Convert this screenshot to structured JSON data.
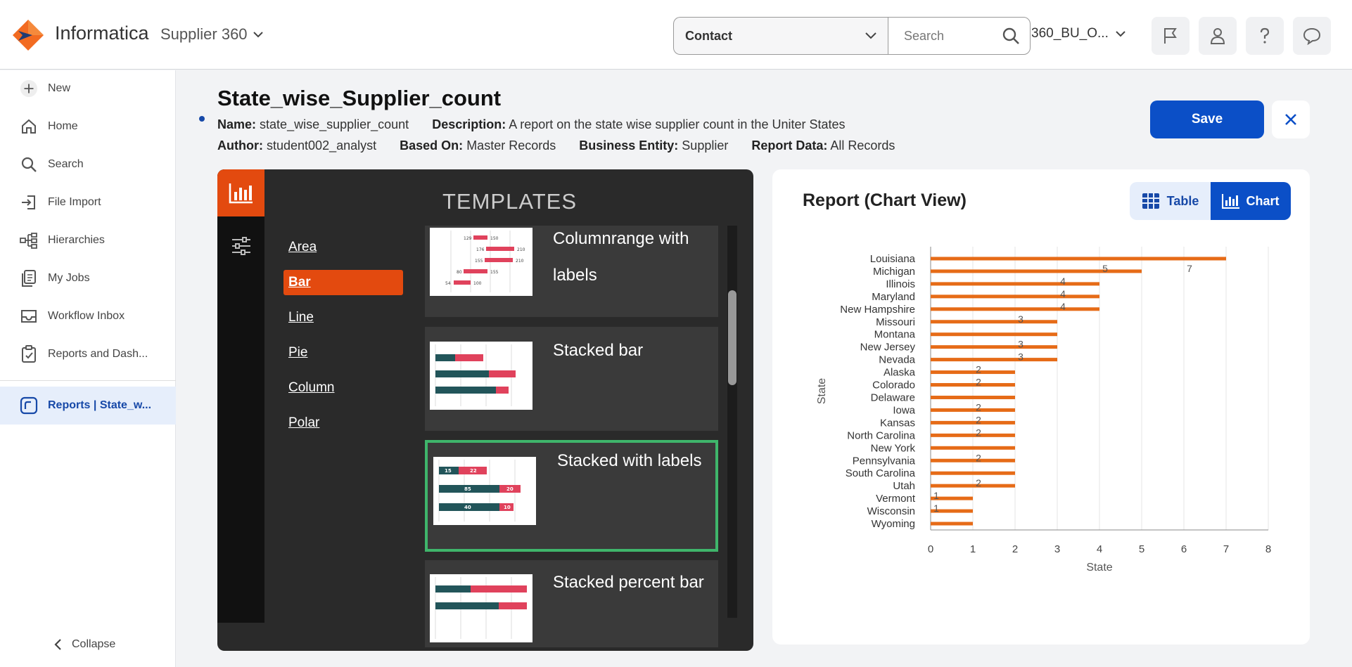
{
  "header": {
    "brand": "Informatica",
    "product": "Supplier 360",
    "entity": "Contact",
    "search_placeholder": "Search",
    "org": "360_BU_O..."
  },
  "sidebar": {
    "items": [
      {
        "label": "New",
        "icon": "plus-icon"
      },
      {
        "label": "Home",
        "icon": "home-icon"
      },
      {
        "label": "Search",
        "icon": "search-icon"
      },
      {
        "label": "File Import",
        "icon": "file-import-icon"
      },
      {
        "label": "Hierarchies",
        "icon": "hierarchy-icon"
      },
      {
        "label": "My Jobs",
        "icon": "jobs-icon"
      },
      {
        "label": "Workflow Inbox",
        "icon": "inbox-icon"
      },
      {
        "label": "Reports and Dash..."
      }
    ],
    "active_tab": "Reports | State_w...",
    "collapse": "Collapse"
  },
  "report": {
    "title": "State_wise_Supplier_count",
    "name_label": "Name:",
    "name": "state_wise_supplier_count",
    "description_label": "Description:",
    "description": "A report on the state wise supplier count in the Uniter States",
    "author_label": "Author:",
    "author": "student002_analyst",
    "based_on_label": "Based On:",
    "based_on": "Master Records",
    "entity_label": "Business Entity:",
    "entity": "Supplier",
    "data_label": "Report Data:",
    "data": "All Records",
    "save": "Save"
  },
  "templates": {
    "heading": "TEMPLATES",
    "types": [
      "Area",
      "Bar",
      "Line",
      "Pie",
      "Column",
      "Polar"
    ],
    "active_type": "Bar",
    "cards": [
      {
        "label": "Columnrange with labels"
      },
      {
        "label": "Stacked bar"
      },
      {
        "label": "Stacked with labels"
      },
      {
        "label": "Stacked percent bar"
      }
    ],
    "selected": "Stacked with labels",
    "thumb_labels": {
      "columnrange": [
        "129",
        "150",
        "176",
        "210",
        "155",
        "210",
        "80",
        "155",
        "54",
        "100"
      ],
      "stacked_labels": [
        "15",
        "22",
        "85",
        "20",
        "40",
        "10"
      ]
    }
  },
  "chart_panel": {
    "title": "Report (Chart View)",
    "table_btn": "Table",
    "chart_btn": "Chart"
  },
  "chart_data": {
    "type": "bar",
    "orientation": "horizontal",
    "categories": [
      "Louisiana",
      "Michigan",
      "Illinois",
      "Maryland",
      "New Hampshire",
      "Missouri",
      "Montana",
      "New Jersey",
      "Nevada",
      "Alaska",
      "Colorado",
      "Delaware",
      "Iowa",
      "Kansas",
      "North Carolina",
      "New York",
      "Pennsylvania",
      "South Carolina",
      "Utah",
      "Vermont",
      "Wisconsin",
      "Wyoming"
    ],
    "values": [
      7,
      5,
      4,
      4,
      4,
      3,
      3,
      3,
      3,
      2,
      2,
      2,
      2,
      2,
      2,
      2,
      2,
      2,
      2,
      1,
      1,
      1
    ],
    "data_labels": [
      {
        "category": "Michigan",
        "text": "5"
      },
      {
        "category": "Michigan",
        "text": "7"
      },
      {
        "category": "Illinois",
        "text": "4"
      },
      {
        "category": "Maryland",
        "text": "4"
      },
      {
        "category": "New Hampshire",
        "text": "4"
      },
      {
        "category": "Missouri",
        "text": "3"
      },
      {
        "category": "New Jersey",
        "text": "3"
      },
      {
        "category": "Nevada",
        "text": "3"
      },
      {
        "category": "Alaska",
        "text": "2"
      },
      {
        "category": "Colorado",
        "text": "2"
      },
      {
        "category": "Iowa",
        "text": "2"
      },
      {
        "category": "Kansas",
        "text": "2"
      },
      {
        "category": "North Carolina",
        "text": "2"
      },
      {
        "category": "Pennsylvania",
        "text": "2"
      },
      {
        "category": "Utah",
        "text": "2"
      },
      {
        "category": "Vermont",
        "text": "1"
      },
      {
        "category": "Wisconsin",
        "text": "1"
      }
    ],
    "xlabel": "State",
    "ylabel": "State",
    "xlim": [
      0,
      8
    ],
    "xticks": [
      0,
      1,
      2,
      3,
      4,
      5,
      6,
      7,
      8
    ],
    "grid": "vertical",
    "bar_color": "#e66b17"
  }
}
